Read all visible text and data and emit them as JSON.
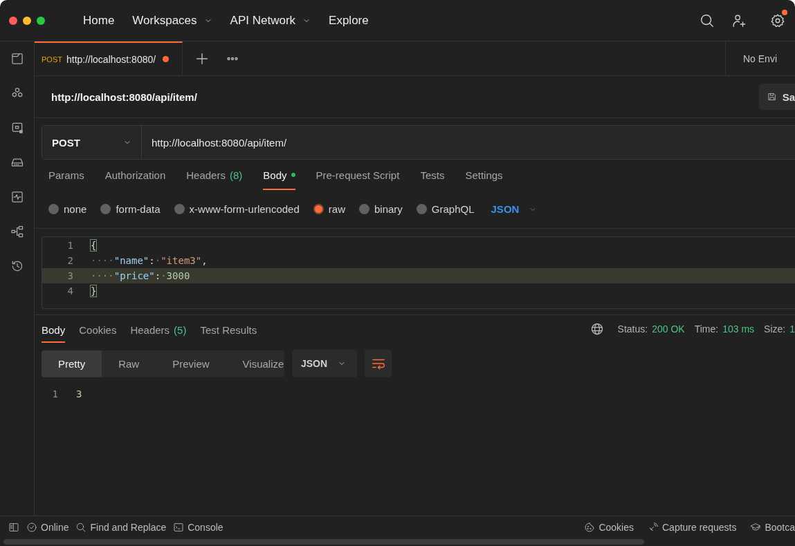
{
  "nav": [
    {
      "label": "Home",
      "has_menu": false
    },
    {
      "label": "Workspaces",
      "has_menu": true
    },
    {
      "label": "API Network",
      "has_menu": true
    },
    {
      "label": "Explore",
      "has_menu": false
    }
  ],
  "settings_notification": true,
  "open_tabs": [
    {
      "method": "POST",
      "url": "http://localhost:8080/",
      "unsaved": true,
      "selected": true
    }
  ],
  "environment": "No Envi",
  "request_title": "http://localhost:8080/api/item/",
  "save_button": "Sa",
  "request": {
    "method": "POST",
    "url": "http://localhost:8080/api/item/"
  },
  "request_tabs": [
    {
      "label": "Params",
      "selected": false
    },
    {
      "label": "Authorization",
      "selected": false
    },
    {
      "label": "Headers",
      "count": "(8)",
      "selected": false
    },
    {
      "label": "Body",
      "indicator": true,
      "selected": true
    },
    {
      "label": "Pre-request Script",
      "selected": false
    },
    {
      "label": "Tests",
      "selected": false
    },
    {
      "label": "Settings",
      "selected": false
    }
  ],
  "body_modes": [
    {
      "label": "none",
      "selected": false
    },
    {
      "label": "form-data",
      "selected": false
    },
    {
      "label": "x-www-form-urlencoded",
      "selected": false
    },
    {
      "label": "raw",
      "selected": true
    },
    {
      "label": "binary",
      "selected": false
    },
    {
      "label": "GraphQL",
      "selected": false
    }
  ],
  "body_language": "JSON",
  "editor_lines": [
    {
      "number": "1",
      "highlighted": false,
      "tokens": [
        {
          "kind": "punct",
          "text": "{",
          "matched": true
        }
      ]
    },
    {
      "number": "2",
      "highlighted": false,
      "tokens": [
        {
          "kind": "ws",
          "text": "····"
        },
        {
          "kind": "key",
          "text": "\"name\""
        },
        {
          "kind": "punct",
          "text": ":"
        },
        {
          "kind": "ws",
          "text": "·"
        },
        {
          "kind": "string",
          "text": "\"item3\""
        },
        {
          "kind": "punct",
          "text": ","
        }
      ]
    },
    {
      "number": "3",
      "highlighted": true,
      "tokens": [
        {
          "kind": "ws",
          "text": "····"
        },
        {
          "kind": "key",
          "text": "\"price\""
        },
        {
          "kind": "punct",
          "text": ":"
        },
        {
          "kind": "ws",
          "text": "·"
        },
        {
          "kind": "number",
          "text": "3000"
        }
      ]
    },
    {
      "number": "4",
      "highlighted": false,
      "tokens": [
        {
          "kind": "punct",
          "text": "}",
          "matched": true
        }
      ]
    }
  ],
  "response_tabs": [
    {
      "label": "Body",
      "selected": true
    },
    {
      "label": "Cookies",
      "selected": false
    },
    {
      "label": "Headers",
      "count": "(5)",
      "selected": false
    },
    {
      "label": "Test Results",
      "selected": false
    }
  ],
  "response_meta": [
    {
      "label": "Status:",
      "value": "200 OK"
    },
    {
      "label": "Time:",
      "value": "103 ms"
    },
    {
      "label": "Size:",
      "value": "1"
    }
  ],
  "view_modes": [
    {
      "label": "Pretty",
      "selected": true
    },
    {
      "label": "Raw",
      "selected": false
    },
    {
      "label": "Preview",
      "selected": false
    },
    {
      "label": "Visualize",
      "selected": false
    }
  ],
  "response_format": "JSON",
  "wrap_lines": true,
  "response_lines": [
    {
      "number": "1",
      "text": "3"
    }
  ],
  "status_left": [
    "Online",
    "Find and Replace",
    "Console"
  ],
  "status_right": [
    "Cookies",
    "Capture requests",
    "Bootca"
  ]
}
